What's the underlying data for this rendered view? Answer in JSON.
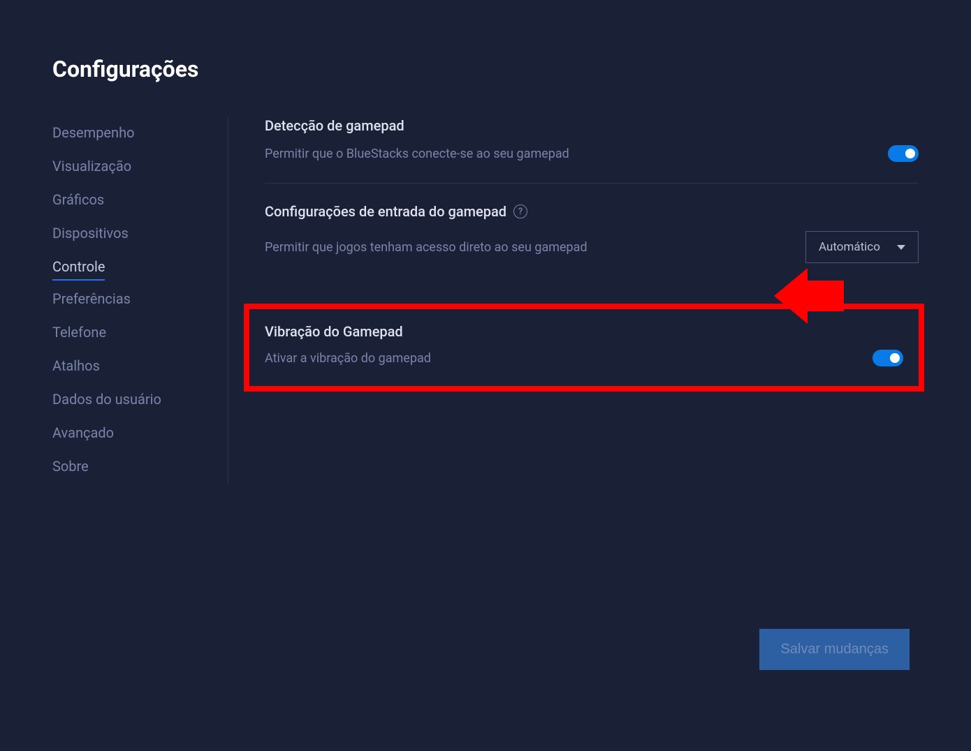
{
  "page": {
    "title": "Configurações"
  },
  "sidebar": {
    "items": [
      {
        "label": "Desempenho"
      },
      {
        "label": "Visualização"
      },
      {
        "label": "Gráficos"
      },
      {
        "label": "Dispositivos"
      },
      {
        "label": "Controle"
      },
      {
        "label": "Preferências"
      },
      {
        "label": "Telefone"
      },
      {
        "label": "Atalhos"
      },
      {
        "label": "Dados do usuário"
      },
      {
        "label": "Avançado"
      },
      {
        "label": "Sobre"
      }
    ],
    "active_index": 4
  },
  "sections": {
    "gamepad_detection": {
      "title": "Detecção de gamepad",
      "desc": "Permitir que o BlueStacks conecte-se ao seu gamepad",
      "toggle_on": true
    },
    "gamepad_input": {
      "title": "Configurações de entrada do gamepad",
      "desc": "Permitir que jogos tenham acesso direto ao seu gamepad",
      "dropdown_selected": "Automático"
    },
    "gamepad_vibration": {
      "title": "Vibração do Gamepad",
      "desc": "Ativar a vibração do gamepad",
      "toggle_on": true
    }
  },
  "footer": {
    "save_label": "Salvar mudanças"
  },
  "colors": {
    "background": "#1a2035",
    "accent": "#0a7be6",
    "highlight": "#fe0000"
  }
}
